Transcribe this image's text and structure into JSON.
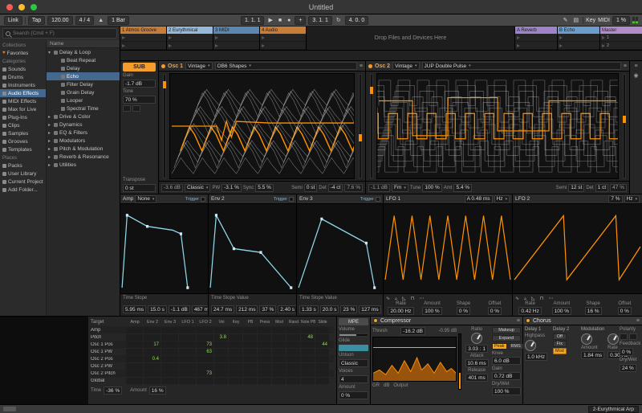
{
  "window": {
    "title": "Untitled"
  },
  "icons": {
    "metronome": "▲",
    "play": "▶",
    "stop": "■",
    "record": "●",
    "plus": "+",
    "loop": "↻",
    "draw": "✎",
    "keyboard": "▤",
    "dropdown": "▾",
    "hamburger": "≡",
    "circle": "◉"
  },
  "transport": {
    "link": "Link",
    "tap": "Tap",
    "tempo": "120.00",
    "time_sig": "4 / 4",
    "quantize": "1 Bar",
    "position": "1. 1. 1",
    "loop_start": "3. 1. 1",
    "loop_length": "4. 0. 0",
    "key_label": "Key",
    "midi_label": "MIDI",
    "cpu": "1 %"
  },
  "browser": {
    "search_placeholder": "Search (Cmd + F)",
    "sections": {
      "collections": "Collections",
      "categories": "Categories",
      "places": "Places"
    },
    "collections": [
      {
        "label": "Favorites",
        "icon": "♥",
        "color": "#e8833a"
      }
    ],
    "categories": [
      {
        "label": "Sounds"
      },
      {
        "label": "Drums"
      },
      {
        "label": "Instruments"
      },
      {
        "label": "Audio Effects",
        "selected": true
      },
      {
        "label": "MIDI Effects"
      },
      {
        "label": "Max for Live"
      },
      {
        "label": "Plug-Ins"
      },
      {
        "label": "Clips"
      },
      {
        "label": "Samples"
      },
      {
        "label": "Grooves"
      },
      {
        "label": "Templates"
      }
    ],
    "places": [
      {
        "label": "Packs"
      },
      {
        "label": "User Library"
      },
      {
        "label": "Current Project"
      },
      {
        "label": "Add Folder..."
      }
    ],
    "list_header": "Name",
    "items": [
      {
        "label": "Delay & Loop",
        "arrow": "▾",
        "depth": 0
      },
      {
        "label": "Beat Repeat",
        "arrow": "",
        "depth": 1
      },
      {
        "label": "Delay",
        "arrow": "",
        "depth": 1
      },
      {
        "label": "Echo",
        "arrow": "",
        "depth": 1,
        "selected": true
      },
      {
        "label": "Filter Delay",
        "arrow": "",
        "depth": 1
      },
      {
        "label": "Grain Delay",
        "arrow": "",
        "depth": 1
      },
      {
        "label": "Looper",
        "arrow": "",
        "depth": 1
      },
      {
        "label": "Spectral Time",
        "arrow": "",
        "depth": 1
      },
      {
        "label": "Drive & Color",
        "arrow": "▸",
        "depth": 0
      },
      {
        "label": "Dynamics",
        "arrow": "▸",
        "depth": 0
      },
      {
        "label": "EQ & Filters",
        "arrow": "▸",
        "depth": 0
      },
      {
        "label": "Modulators",
        "arrow": "▸",
        "depth": 0
      },
      {
        "label": "Pitch & Modulation",
        "arrow": "▸",
        "depth": 0
      },
      {
        "label": "Reverb & Resonance",
        "arrow": "▸",
        "depth": 0
      },
      {
        "label": "Utilities",
        "arrow": "▸",
        "depth": 0
      }
    ]
  },
  "session": {
    "tracks": [
      {
        "label": "1 Atmos Groove",
        "color": "#c77c38"
      },
      {
        "label": "2 Eurythmical",
        "color": "#96b9d9",
        "selected": true
      },
      {
        "label": "3 MIDI",
        "color": "#5c88b0"
      },
      {
        "label": "4 Audio",
        "color": "#c77c38"
      }
    ],
    "drop_text": "Drop Files and Devices Here",
    "returns": [
      {
        "label": "A Reverb",
        "color": "#9d84c8"
      },
      {
        "label": "B Echo",
        "color": "#6c9ccc"
      }
    ],
    "master": {
      "label": "Master",
      "color": "#b08cc9"
    },
    "scenes": [
      "1",
      "2"
    ]
  },
  "synth": {
    "sub": {
      "label": "SUB",
      "gain_label": "Gain",
      "gain": "-1.7 dB",
      "tone_label": "Tone",
      "tone": "70 %",
      "transpose_label": "Transpose",
      "transpose": "0 st"
    },
    "osc1": {
      "name": "Osc 1",
      "category": "Vintage",
      "wavetable": "OB6 Shapes",
      "gain": "-3.6 dB",
      "position": "7.6 %",
      "mode": "Classic",
      "p1_label": "PW",
      "p1": "-3.1 %",
      "p2_label": "Sync",
      "p2": "5.5 %",
      "semi_label": "Semi",
      "semi": "0 st",
      "det_label": "Det",
      "det": "-4 ct"
    },
    "osc2": {
      "name": "Osc 2",
      "category": "Vintage",
      "wavetable": "JUP Double Pulse",
      "gain": "-1.1 dB",
      "position": "47 %",
      "mode": "Fm",
      "p1_label": "Tune",
      "p1": "100 %",
      "p2_label": "Amt",
      "p2": "5.4 %",
      "semi_label": "Semi",
      "semi": "12 st",
      "det_label": "Det",
      "det": "1 ct"
    },
    "envelopes": [
      {
        "name": "Amp",
        "menu": "None",
        "trigger": "Trigger",
        "cols": "Time  Slope",
        "values": [
          "5.95 ms",
          "15.0 s",
          "-1.1 dB",
          "467 ms"
        ]
      },
      {
        "name": "Env 2",
        "trigger": "Trigger",
        "cols": "Time  Slope  Value",
        "values": [
          "24.7 ms",
          "212 ms",
          "37 %",
          "2.40 s"
        ]
      },
      {
        "name": "Env 3",
        "trigger": "Trigger",
        "cols": "Time  Slope  Value",
        "values": [
          "1.33 s",
          "20.0 s",
          "23 %",
          "127 ms"
        ]
      }
    ],
    "lfos": [
      {
        "name": "LFO 1",
        "info": "A 0.48 ms",
        "unit": "Hz",
        "shapes": [
          "∿",
          "▵",
          "◺",
          "⊓",
          "⋯"
        ],
        "values": [
          {
            "l": "Rate",
            "v": "20.00 Hz"
          },
          {
            "l": "Amount",
            "v": "100 %"
          },
          {
            "l": "Shape",
            "v": "0 %"
          },
          {
            "l": "Offset",
            "v": "0 %"
          }
        ]
      },
      {
        "name": "LFO 2",
        "info": "7 %",
        "unit": "Hz",
        "shapes": [
          "∿",
          "▵",
          "◺",
          "⊓",
          "⋯"
        ],
        "values": [
          {
            "l": "Rate",
            "v": "0.42 Hz"
          },
          {
            "l": "Amount",
            "v": "100 %"
          },
          {
            "l": "Shape",
            "v": "16 %"
          },
          {
            "l": "Offset",
            "v": "0 %"
          }
        ]
      }
    ]
  },
  "matrix": {
    "target_label": "Target",
    "mod_cols": [
      {
        "label": "Amp"
      },
      {
        "label": "Env 2"
      },
      {
        "label": "Env 3"
      },
      {
        "label": "LFO 1"
      },
      {
        "label": "LFO 2"
      }
    ],
    "midi_cols": [
      {
        "label": "Vel"
      },
      {
        "label": "Key"
      },
      {
        "label": "PB"
      },
      {
        "label": "Press"
      },
      {
        "label": "Mod"
      },
      {
        "label": "Rand"
      },
      {
        "label": "Note PB"
      },
      {
        "label": "Slide"
      }
    ],
    "rows": [
      {
        "target": "Amp",
        "cells": [
          "",
          "",
          "",
          "",
          "",
          "",
          "",
          "",
          "",
          "",
          "",
          "",
          ""
        ]
      },
      {
        "target": "Pitch",
        "cells": [
          "",
          "",
          "",
          "",
          "",
          "3.8",
          "",
          "",
          "",
          "",
          "",
          "48",
          ""
        ]
      },
      {
        "target": "Osc 1 Pos",
        "cells": [
          "",
          "17",
          "",
          "",
          "73",
          "",
          "",
          "",
          "",
          "",
          "",
          "",
          "44"
        ]
      },
      {
        "target": "Osc 1 PW",
        "cells": [
          "",
          "",
          "",
          "",
          "63",
          "",
          "",
          "",
          "",
          "",
          "",
          "",
          ""
        ]
      },
      {
        "target": "Osc 2 Pos",
        "cells": [
          "",
          "0.4",
          "",
          "",
          "",
          "",
          "",
          "",
          "",
          "",
          "",
          "",
          ""
        ]
      },
      {
        "target": "Osc 2 PW",
        "cells": [
          "",
          "",
          "",
          "",
          "",
          "",
          "",
          "",
          "",
          "",
          "",
          "",
          ""
        ]
      },
      {
        "target": "Osc 2 Pitch",
        "cells": [
          "",
          "",
          "",
          "",
          "73",
          "",
          "",
          "",
          "",
          "",
          "",
          "",
          ""
        ]
      },
      {
        "target": "Global",
        "cells": [
          "",
          "",
          "",
          "",
          "",
          "",
          "",
          "",
          "",
          "",
          "",
          "",
          ""
        ]
      }
    ],
    "footer": [
      {
        "l": "Time",
        "v": "-36 %"
      },
      {
        "l": "Amount",
        "v": "16 %"
      }
    ]
  },
  "mpe": {
    "tab": "MPE",
    "volume_label": "Volume",
    "glide_label": "Glide",
    "unison_label": "Unison",
    "unison_value": "Classic",
    "voices_label": "Voices",
    "voices_value": "4",
    "amount_label": "Amount",
    "amount_value": "0 %"
  },
  "compressor": {
    "title": "Compressor",
    "thresh_label": "Thresh",
    "thresh": "-16.2 dB",
    "out": "-0.95 dB",
    "meter_gr": "GR",
    "meter_db": "dB",
    "meter_output": "Output",
    "ratio_label": "Ratio",
    "ratio": "3.03 : 1",
    "attack_label": "Attack",
    "attack": "10.6 ms",
    "release_label": "Release",
    "release": "401 ms",
    "mode_peak": "Peak",
    "mode_rms": "RMS",
    "makeup_label": "Makeup",
    "expand_label": "Expand",
    "knee_label": "Knee",
    "knee": "6.0 dB",
    "gain_label": "Gain",
    "gain": "0.72 dB",
    "drywet_label": "Dry/Wet",
    "drywet": "100 %"
  },
  "chorus": {
    "title": "Chorus",
    "delay1_label": "Delay 1",
    "highpass_label": "Highpass",
    "highpass": "1.0 kHz",
    "delay2_label": "Delay 2",
    "modes": [
      {
        "label": "Off"
      },
      {
        "label": "Fix"
      },
      {
        "label": "Mod",
        "selected": true
      }
    ],
    "mod_label": "Modulation",
    "amount_label": "Amount",
    "amount": "1.84 ms",
    "rate_label": "Rate",
    "rate": "0.30 Hz",
    "polarity_label": "Polarity",
    "feedback_label": "Feedback",
    "feedback": "0 %",
    "drywet_label": "Dry/Wet",
    "drywet": "24 %"
  },
  "status": {
    "clip_name": "2-Eurythmical Arp"
  }
}
